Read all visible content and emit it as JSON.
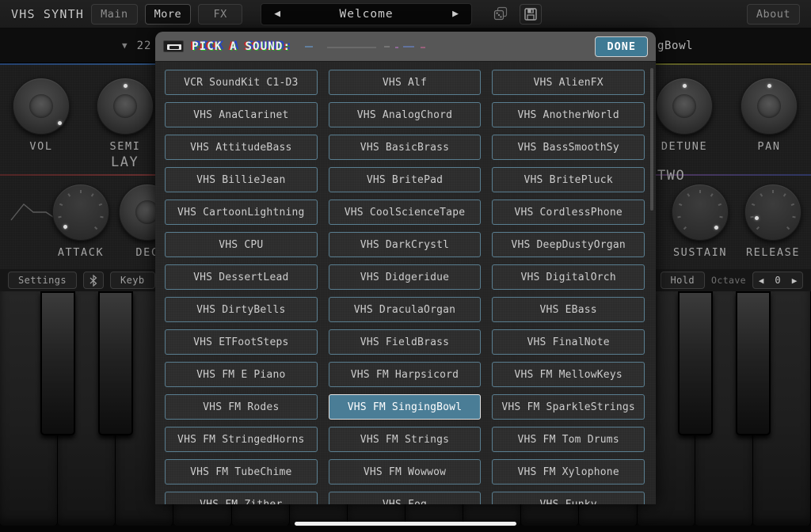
{
  "toolbar": {
    "brand": "VHS SYNTH",
    "tabs": [
      {
        "label": "Main",
        "active": false
      },
      {
        "label": "More",
        "active": true
      },
      {
        "label": "FX",
        "active": false
      }
    ],
    "preset_nav": {
      "prev_icon": "◀",
      "name": "Welcome",
      "next_icon": "▶"
    },
    "dice_icon": "⚄",
    "save_icon": "floppy-disk",
    "about_label": "About"
  },
  "preset_bar": {
    "chevron": "▼",
    "index": "22",
    "current_preset": "gBowl"
  },
  "osc1": {
    "title": "LAY",
    "knobs": [
      {
        "label": "VOL",
        "angle": 140
      },
      {
        "label": "SEMI",
        "angle": 0
      },
      {
        "label": "DETUNE",
        "angle": 0
      },
      {
        "label": "PAN",
        "angle": 0
      }
    ]
  },
  "osc2": {
    "title": "TWO",
    "knobs": [
      {
        "label": "ATTACK",
        "angle": -125
      },
      {
        "label": "DEC",
        "angle": 0
      },
      {
        "label": "SUSTAIN",
        "angle": 130
      },
      {
        "label": "RELEASE",
        "angle": -120
      }
    ],
    "env_icon": "adsr-envelope-icon"
  },
  "control_row": {
    "settings_label": "Settings",
    "bluetooth_icon": "ᛒ",
    "keyboard_label": "Keyb",
    "warning_icon": "⚠",
    "hold_label": "Hold",
    "octave_label": "Octave",
    "octave_prev": "◀",
    "octave_value": "0",
    "octave_next": "▶"
  },
  "modal": {
    "cassette_icon": "cassette-icon",
    "title": "PICK A SOUND:",
    "done_label": "DONE",
    "selected": "VHS FM SingingBowl",
    "presets": [
      "VCR SoundKit C1-D3",
      "VHS Alf",
      "VHS AlienFX",
      "VHS AnaClarinet",
      "VHS AnalogChord",
      "VHS AnotherWorld",
      "VHS AttitudeBass",
      "VHS BasicBrass",
      "VHS BassSmoothSy",
      "VHS BillieJean",
      "VHS BritePad",
      "VHS BritePluck",
      "VHS CartoonLightning",
      "VHS CoolScienceTape",
      "VHS CordlessPhone",
      "VHS CPU",
      "VHS DarkCrystl",
      "VHS DeepDustyOrgan",
      "VHS DessertLead",
      "VHS Didgeridue",
      "VHS DigitalOrch",
      "VHS DirtyBells",
      "VHS DraculaOrgan",
      "VHS EBass",
      "VHS ETFootSteps",
      "VHS FieldBrass",
      "VHS FinalNote",
      "VHS FM E Piano",
      "VHS FM Harpsicord",
      "VHS FM MellowKeys",
      "VHS FM Rodes",
      "VHS FM SingingBowl",
      "VHS FM SparkleStrings",
      "VHS FM StringedHorns",
      "VHS FM Strings",
      "VHS FM Tom Drums",
      "VHS FM TubeChime",
      "VHS FM Wowwow",
      "VHS FM Xylophone",
      "VHS FM Zither",
      "VHS Fog",
      "VHS Funky"
    ]
  },
  "colors": {
    "accent_selected": "#4a7d96",
    "item_border": "#5a7e90",
    "done_button": "#3f7a94",
    "panel_bg": "#1c1c1c",
    "modal_header": "#575757"
  }
}
